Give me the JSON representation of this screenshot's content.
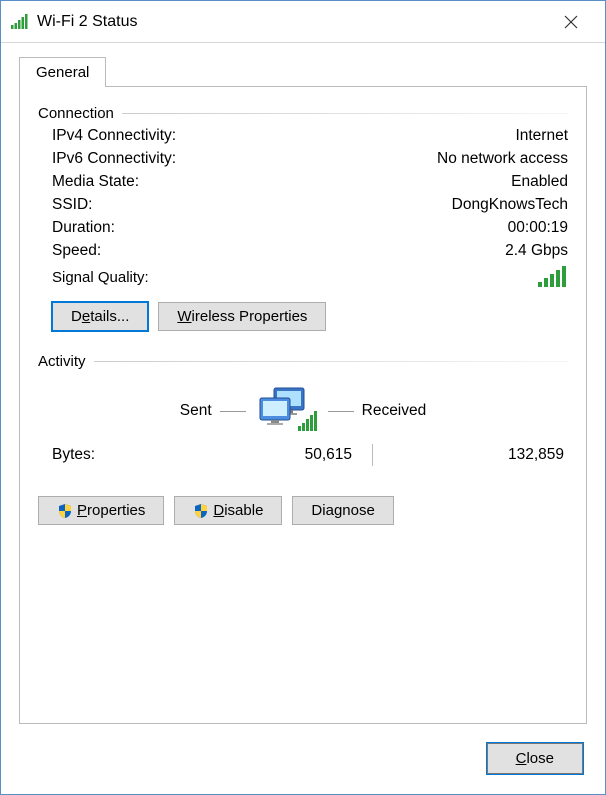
{
  "window": {
    "title": "Wi-Fi 2 Status"
  },
  "tabs": {
    "general": "General"
  },
  "connection": {
    "legend": "Connection",
    "rows": {
      "ipv4_label": "IPv4 Connectivity:",
      "ipv4_value": "Internet",
      "ipv6_label": "IPv6 Connectivity:",
      "ipv6_value": "No network access",
      "media_label": "Media State:",
      "media_value": "Enabled",
      "ssid_label": "SSID:",
      "ssid_value": "DongKnowsTech",
      "duration_label": "Duration:",
      "duration_value": "00:00:19",
      "speed_label": "Speed:",
      "speed_value": "2.4 Gbps",
      "signal_label": "Signal Quality:"
    },
    "buttons": {
      "details": "Details...",
      "wireless_props": "Wireless Properties"
    }
  },
  "activity": {
    "legend": "Activity",
    "sent_label": "Sent",
    "recv_label": "Received",
    "bytes_label": "Bytes:",
    "bytes_sent": "50,615",
    "bytes_recv": "132,859"
  },
  "buttons": {
    "properties": "Properties",
    "disable": "Disable",
    "diagnose": "Diagnose",
    "close": "Close"
  }
}
